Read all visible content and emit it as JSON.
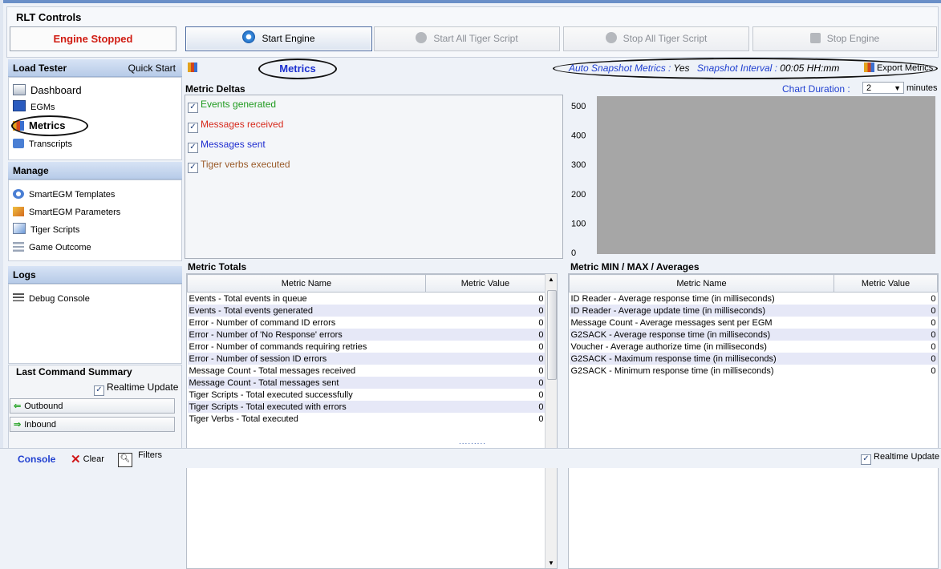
{
  "rlt": {
    "title": "RLT Controls",
    "status": "Engine Stopped",
    "buttons": [
      {
        "label": "Start Engine",
        "icon": "power-icon",
        "enabled": true
      },
      {
        "label": "Start All Tiger Script",
        "icon": "play-icon",
        "enabled": false
      },
      {
        "label": "Stop All Tiger Script",
        "icon": "stop-icon",
        "enabled": false
      },
      {
        "label": "Stop Engine",
        "icon": "stop-icon",
        "enabled": false
      }
    ]
  },
  "sidebar": {
    "load_tester": {
      "title": "Load Tester",
      "quick_start": "Quick Start",
      "items": [
        "Dashboard",
        "EGMs",
        "Metrics",
        "Transcripts"
      ]
    },
    "manage": {
      "title": "Manage",
      "items": [
        "SmartEGM Templates",
        "SmartEGM Parameters",
        "Tiger Scripts",
        "Game Outcome"
      ]
    },
    "logs": {
      "title": "Logs",
      "items": [
        "Debug Console"
      ]
    },
    "last_command": {
      "title": "Last Command Summary",
      "realtime": "Realtime Update",
      "outbound": "Outbound",
      "inbound": "Inbound"
    }
  },
  "main": {
    "title": "Metrics",
    "snapshot": {
      "auto_label": "Auto Snapshot Metrics :",
      "auto_value": "Yes",
      "interval_label": "Snapshot Interval :",
      "interval_value": "00:05 HH:mm",
      "export": "Export Metrics"
    },
    "chart_duration": {
      "label": "Chart Duration :",
      "value": "2",
      "unit": "minutes"
    },
    "deltas": {
      "title": "Metric Deltas",
      "items": [
        {
          "label": "Events generated",
          "color": "#1e9a1e"
        },
        {
          "label": "Messages received",
          "color": "#d72a1c"
        },
        {
          "label": "Messages sent",
          "color": "#1f2ed0"
        },
        {
          "label": "Tiger verbs executed",
          "color": "#9a5b2a"
        }
      ]
    },
    "totals": {
      "title": "Metric Totals",
      "columns": [
        "Metric Name",
        "Metric Value"
      ],
      "rows": [
        [
          "Events - Total events in queue",
          "0"
        ],
        [
          "Events - Total events generated",
          "0"
        ],
        [
          "Error - Number of command ID errors",
          "0"
        ],
        [
          "Error - Number of 'No Response' errors",
          "0"
        ],
        [
          "Error - Number of commands requiring retries",
          "0"
        ],
        [
          "Error - Number of session ID errors",
          "0"
        ],
        [
          "Message Count - Total messages received",
          "0"
        ],
        [
          "Message Count - Total messages sent",
          "0"
        ],
        [
          "Tiger Scripts - Total executed successfully",
          "0"
        ],
        [
          "Tiger Scripts - Total executed with errors",
          "0"
        ],
        [
          "Tiger Verbs - Total executed",
          "0"
        ]
      ]
    },
    "minmax": {
      "title": "Metric MIN / MAX / Averages",
      "columns": [
        "Metric Name",
        "Metric Value"
      ],
      "rows": [
        [
          "ID Reader - Average response time (in milliseconds)",
          "0"
        ],
        [
          "ID Reader - Average update time (in milliseconds)",
          "0"
        ],
        [
          "Message Count - Average messages sent per EGM",
          "0"
        ],
        [
          "G2SACK - Average response time (in milliseconds)",
          "0"
        ],
        [
          "Voucher - Average authorize time (in milliseconds)",
          "0"
        ],
        [
          "G2SACK - Maximum response time (in milliseconds)",
          "0"
        ],
        [
          "G2SACK - Minimum response time (in milliseconds)",
          "0"
        ]
      ]
    }
  },
  "chart_data": {
    "type": "line",
    "ylim": [
      0,
      500
    ],
    "yticks": [
      "0",
      "100",
      "200",
      "300",
      "400",
      "500"
    ],
    "series": []
  },
  "console": {
    "label": "Console",
    "clear": "Clear",
    "filters": "Filters",
    "realtime": "Realtime Update",
    "splitter": "........."
  }
}
